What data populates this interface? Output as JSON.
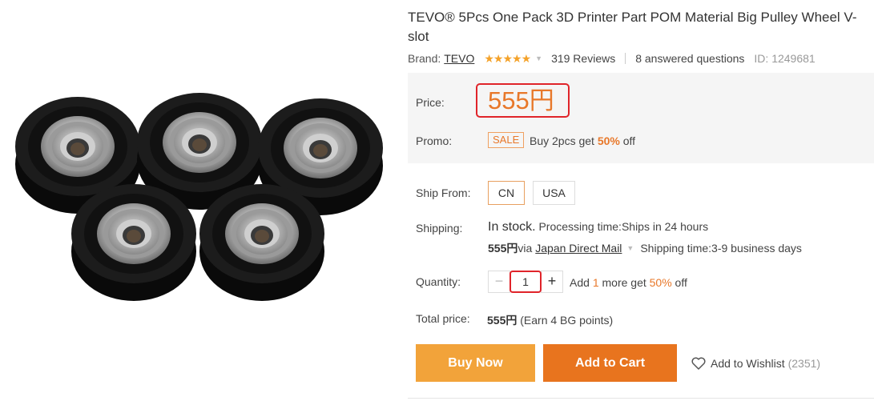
{
  "product": {
    "title": "TEVO® 5Pcs One Pack 3D Printer Part POM Material Big Pulley Wheel V-slot",
    "brand_label": "Brand:",
    "brand_name": "TEVO",
    "rating_stars": "★★★★★",
    "reviews": "319 Reviews",
    "answered": "8 answered questions",
    "id_text": "ID: 1249681"
  },
  "price": {
    "label": "Price:",
    "amount": "555円",
    "promo_label": "Promo:",
    "sale_badge": "SALE",
    "promo_text_prefix": "Buy 2pcs get ",
    "promo_pct": "50%",
    "promo_text_suffix": " off"
  },
  "shipping": {
    "ship_from_label": "Ship From:",
    "options": [
      "CN",
      "USA"
    ],
    "selected": "CN",
    "shipping_label": "Shipping:",
    "in_stock": "In stock.",
    "processing": " Processing time:Ships in 24 hours",
    "ship_price": "555円",
    "via": " via",
    "method": "Japan Direct Mail",
    "ship_time": "Shipping time:3-9 business days"
  },
  "quantity": {
    "label": "Quantity:",
    "minus": "−",
    "value": "1",
    "plus": "+",
    "promo_prefix": "Add ",
    "promo_count": "1",
    "promo_mid": " more get ",
    "promo_pct": "50%",
    "promo_suffix": " off"
  },
  "total": {
    "label": "Total price:",
    "amount": "555円",
    "points": " (Earn 4 BG points)"
  },
  "actions": {
    "buy_now": "Buy Now",
    "add_to_cart": "Add to Cart",
    "wishlist": "Add to Wishlist",
    "wishlist_count": "(2351)"
  },
  "colors": {
    "accent_orange": "#e8782a",
    "buy_now_bg": "#f2a33a",
    "add_cart_bg": "#e8741e",
    "highlight_red": "#e0242a",
    "star": "#f4a22a"
  }
}
